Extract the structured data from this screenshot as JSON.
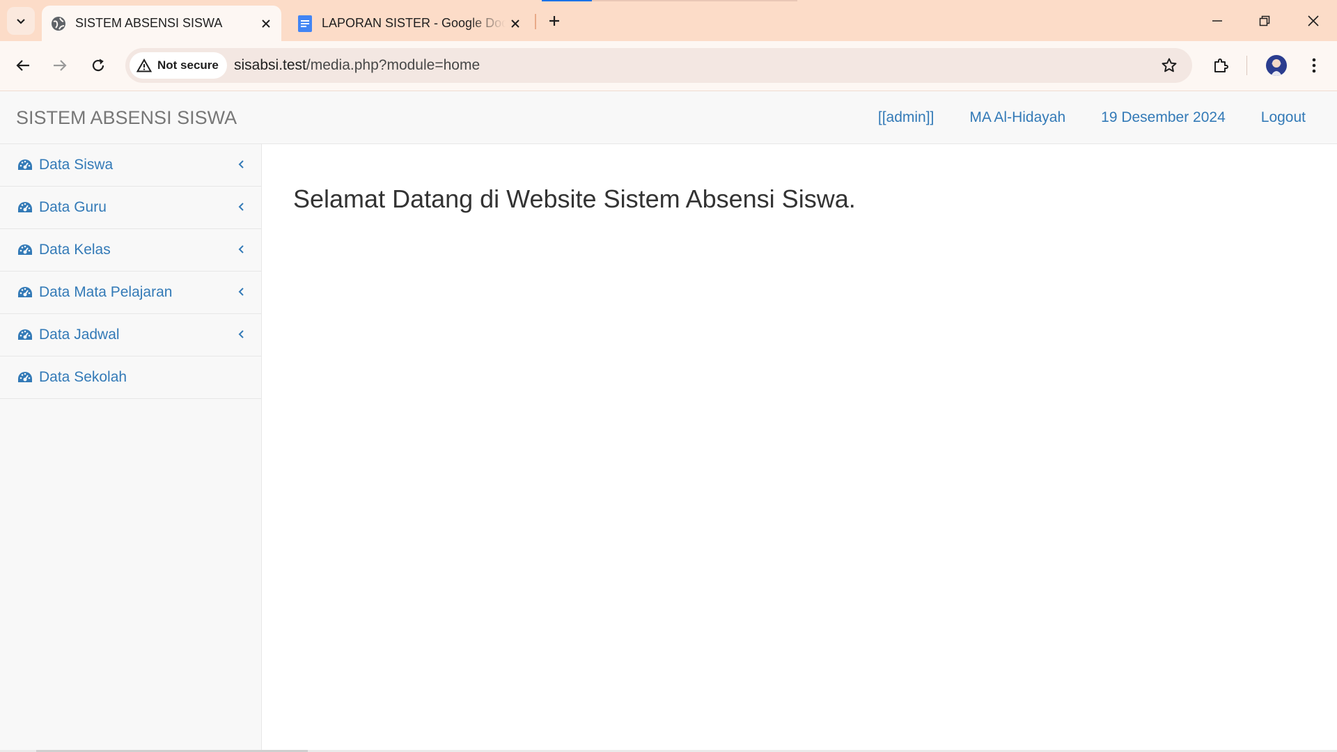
{
  "browser": {
    "tabs": [
      {
        "title": "SISTEM ABSENSI SISWA",
        "icon": "globe-icon",
        "active": true
      },
      {
        "title": "LAPORAN SISTER - Google Docs",
        "icon": "google-docs-icon",
        "active": false
      }
    ],
    "security_label": "Not secure",
    "url_host": "sisabsi.test",
    "url_path": "/media.php?module=home",
    "accent": "#1a73e8",
    "tabstrip_color": "#fcdcc8"
  },
  "navbar": {
    "brand": "SISTEM ABSENSI SISWA",
    "user": "[[admin]]",
    "school": "MA Al-Hidayah",
    "date": "19 Desember 2024",
    "logout": "Logout"
  },
  "sidebar": {
    "items": [
      {
        "label": "Data Siswa",
        "icon": "dashboard-icon",
        "has_submenu": true
      },
      {
        "label": "Data Guru",
        "icon": "dashboard-icon",
        "has_submenu": true
      },
      {
        "label": "Data Kelas",
        "icon": "dashboard-icon",
        "has_submenu": true
      },
      {
        "label": "Data Mata Pelajaran",
        "icon": "dashboard-icon",
        "has_submenu": true
      },
      {
        "label": "Data Jadwal",
        "icon": "dashboard-icon",
        "has_submenu": true
      },
      {
        "label": "Data Sekolah",
        "icon": "dashboard-icon",
        "has_submenu": false
      }
    ]
  },
  "main": {
    "welcome": "Selamat Datang di Website Sistem Absensi Siswa."
  },
  "colors": {
    "link": "#337ab7",
    "brand_text": "#777777",
    "navbar_bg": "#f8f8f8"
  }
}
